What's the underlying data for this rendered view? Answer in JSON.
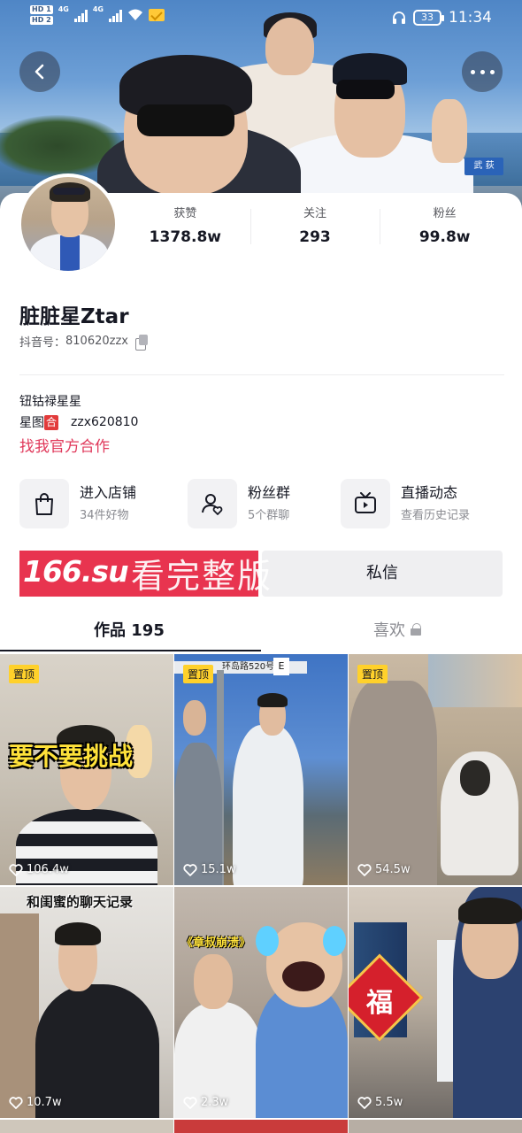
{
  "status_bar": {
    "hd1": "HD 1",
    "hd2": "HD 2",
    "net1": "4G",
    "net2": "4G",
    "battery": "33",
    "time": "11:34"
  },
  "cover": {
    "road_sign": "武 荻"
  },
  "profile": {
    "stats": [
      {
        "label": "获赞",
        "value": "1378.8w"
      },
      {
        "label": "关注",
        "value": "293"
      },
      {
        "label": "粉丝",
        "value": "99.8w"
      }
    ],
    "nickname": "脏脏星Ztar",
    "id_label": "抖音号：",
    "id_value": "810620zzx",
    "bio_line1": "钮钴禄星星",
    "bio_line2_prefix": "星图",
    "bio_line2_badge": "合",
    "bio_line2_value": "zzx620810",
    "bio_link": "找我官方合作"
  },
  "entries": [
    {
      "title": "进入店铺",
      "subtitle": "34件好物",
      "icon": "bag-icon"
    },
    {
      "title": "粉丝群",
      "subtitle": "5个群聊",
      "icon": "fans-group-icon"
    },
    {
      "title": "直播动态",
      "subtitle": "查看历史记录",
      "icon": "tv-icon"
    }
  ],
  "promo": {
    "brand": "166.su",
    "text": "看完整版"
  },
  "actions": {
    "dm_label": "私信"
  },
  "tabs": {
    "works_label": "作品 195",
    "likes_label": "喜欢"
  },
  "videos": [
    {
      "pinned": "置顶",
      "likes": "106.4w",
      "caption": "要不要挑战"
    },
    {
      "pinned": "置顶",
      "likes": "15.1w",
      "caption": "环岛路520号",
      "sign_letter": "E"
    },
    {
      "pinned": "置顶",
      "likes": "54.5w",
      "caption": ""
    },
    {
      "pinned": "",
      "likes": "10.7w",
      "caption": "和闺蜜的聊天记录"
    },
    {
      "pinned": "",
      "likes": "2.3w",
      "caption": "《章叔崩溃》"
    },
    {
      "pinned": "",
      "likes": "5.5w",
      "caption": "福"
    }
  ],
  "colors": {
    "accent_link": "#e0395b",
    "promo_bg": "#e8344f",
    "pin_badge": "#ffd12b",
    "text_primary": "#161823",
    "text_secondary": "#8a8b91"
  }
}
